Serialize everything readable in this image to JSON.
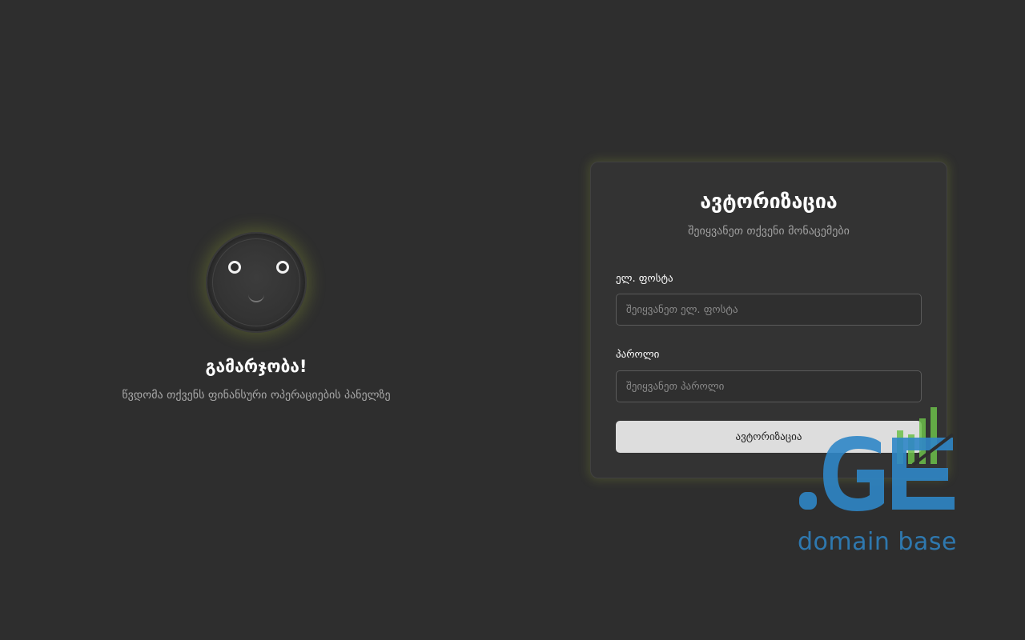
{
  "welcome": {
    "title": "გამარჯობა!",
    "subtitle": "წვდომა თქვენს ფინანსური ოპერაციების პანელზე"
  },
  "login": {
    "title": "ავტორიზაცია",
    "subtitle": "შეიყვანეთ თქვენი მონაცემები",
    "email_label": "ელ. ფოსტა",
    "email_placeholder": "შეიყვანეთ ელ. ფოსტა",
    "email_value": "",
    "password_label": "პაროლი",
    "password_placeholder": "შეიყვანეთ პაროლი",
    "password_value": "",
    "submit_label": "ავტორიზაცია"
  },
  "watermark": {
    "logo_text": ".GE",
    "caption": "domain base"
  },
  "colors": {
    "background": "#2e2e2e",
    "card": "#333333",
    "glow": "#96aa32",
    "button": "#dddddd",
    "watermark_blue": "#2f86c6",
    "watermark_green": "#6cc04a"
  },
  "icons": {
    "avatar": "smiley-face-icon",
    "watermark": "bar-chart-logo-icon"
  }
}
